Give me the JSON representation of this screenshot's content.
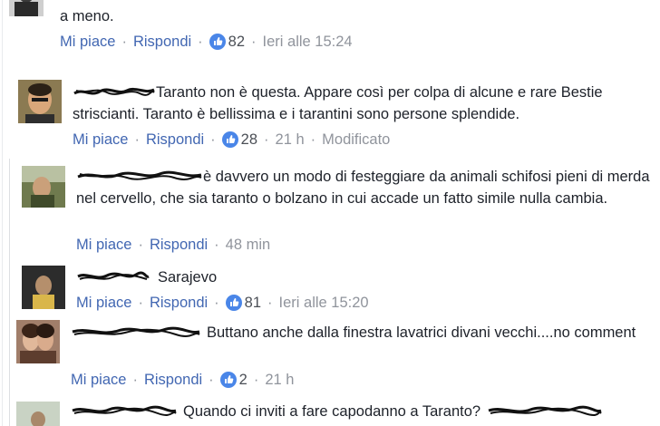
{
  "actions": {
    "like": "Mi piace",
    "reply": "Rispondi",
    "separator": "·"
  },
  "comments": [
    {
      "text_prefix": "",
      "text": "a meno.",
      "reactions": "82",
      "time": "Ieri alle 15:24",
      "edited": ""
    },
    {
      "text": "Taranto non è questa. Appare così per colpa di alcune e rare Bestie striscianti. Taranto è bellissima e i tarantini sono persone splendide.",
      "reactions": "28",
      "time": "21 h",
      "edited": "Modificato"
    },
    {
      "text": "è davvero un modo di festeggiare da animali schifosi pieni di merda nel cervello, che sia taranto o bolzano in cui accade un fatto simile nulla cambia.",
      "reactions": "",
      "time": "48 min",
      "edited": ""
    },
    {
      "text": "Sarajevo",
      "reactions": "81",
      "time": "Ieri alle 15:20",
      "edited": ""
    },
    {
      "text": "Buttano anche dalla finestra lavatrici divani vecchi....no comment",
      "reactions": "2",
      "time": "21 h",
      "edited": ""
    },
    {
      "text": "Quando ci inviti a fare capodanno a Taranto?",
      "reactions": "",
      "time": "",
      "edited": ""
    }
  ],
  "colors": {
    "link": "#4267b2",
    "meta": "#90949c",
    "text": "#1d2129",
    "like_badge": "#4a86e8"
  }
}
